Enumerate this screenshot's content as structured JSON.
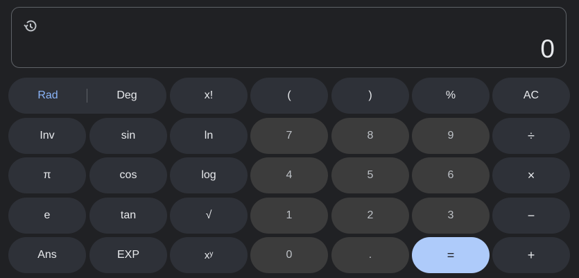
{
  "display": {
    "history_icon": "history-icon",
    "value": "0"
  },
  "keys": {
    "rad": "Rad",
    "deg": "Deg",
    "factorial": "x!",
    "lparen": "(",
    "rparen": ")",
    "percent": "%",
    "clear": "AC",
    "inv": "Inv",
    "sin": "sin",
    "ln": "ln",
    "n7": "7",
    "n8": "8",
    "n9": "9",
    "divide": "÷",
    "pi": "π",
    "cos": "cos",
    "log": "log",
    "n4": "4",
    "n5": "5",
    "n6": "6",
    "multiply": "×",
    "e": "e",
    "tan": "tan",
    "sqrt": "√",
    "n1": "1",
    "n2": "2",
    "n3": "3",
    "minus": "−",
    "ans": "Ans",
    "exp": "EXP",
    "power": "xʸ",
    "n0": "0",
    "dot": ".",
    "equals": "=",
    "plus": "+"
  },
  "colors": {
    "background": "#202124",
    "function_key": "#2e3138",
    "number_key": "#3c3c3c",
    "equals_key": "#aecbfa",
    "accent": "#8ab4f8"
  }
}
